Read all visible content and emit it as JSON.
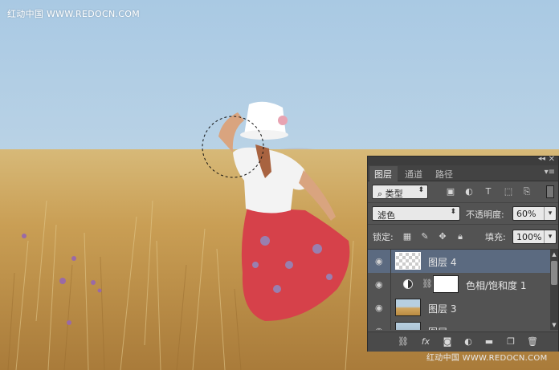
{
  "watermark": {
    "top": "红动中国 WWW.REDOCN.COM",
    "bottom": "红动中国 WWW.REDOCN.COM"
  },
  "layers_panel": {
    "tabs": [
      "图层",
      "通道",
      "路径"
    ],
    "active_tab": "图层",
    "filter": {
      "kind_label": "类型",
      "icons": [
        "image-filter-icon",
        "adjustment-filter-icon",
        "type-filter-icon",
        "shape-filter-icon",
        "smart-object-filter-icon"
      ]
    },
    "blend_mode": "滤色",
    "opacity_label": "不透明度:",
    "opacity_value": "60%",
    "lock_label": "锁定:",
    "fill_label": "填充:",
    "fill_value": "100%",
    "layers": [
      {
        "name": "图层 4",
        "thumbnail": "transparent",
        "visible": true,
        "selected": true
      },
      {
        "name": "色相/饱和度 1",
        "thumbnail": "adjustment-mask",
        "visible": true,
        "selected": false
      },
      {
        "name": "图层 3",
        "thumbnail": "photo",
        "visible": true,
        "selected": false
      },
      {
        "name": "图层",
        "thumbnail": "photo",
        "visible": true,
        "selected": false
      }
    ],
    "footer_icons": [
      "link-layers-icon",
      "fx-icon",
      "add-mask-icon",
      "new-adjustment-icon",
      "new-group-icon",
      "new-layer-icon",
      "delete-layer-icon"
    ]
  },
  "colors": {
    "panel_bg": "#535353",
    "selected_layer": "#5b6a80"
  }
}
